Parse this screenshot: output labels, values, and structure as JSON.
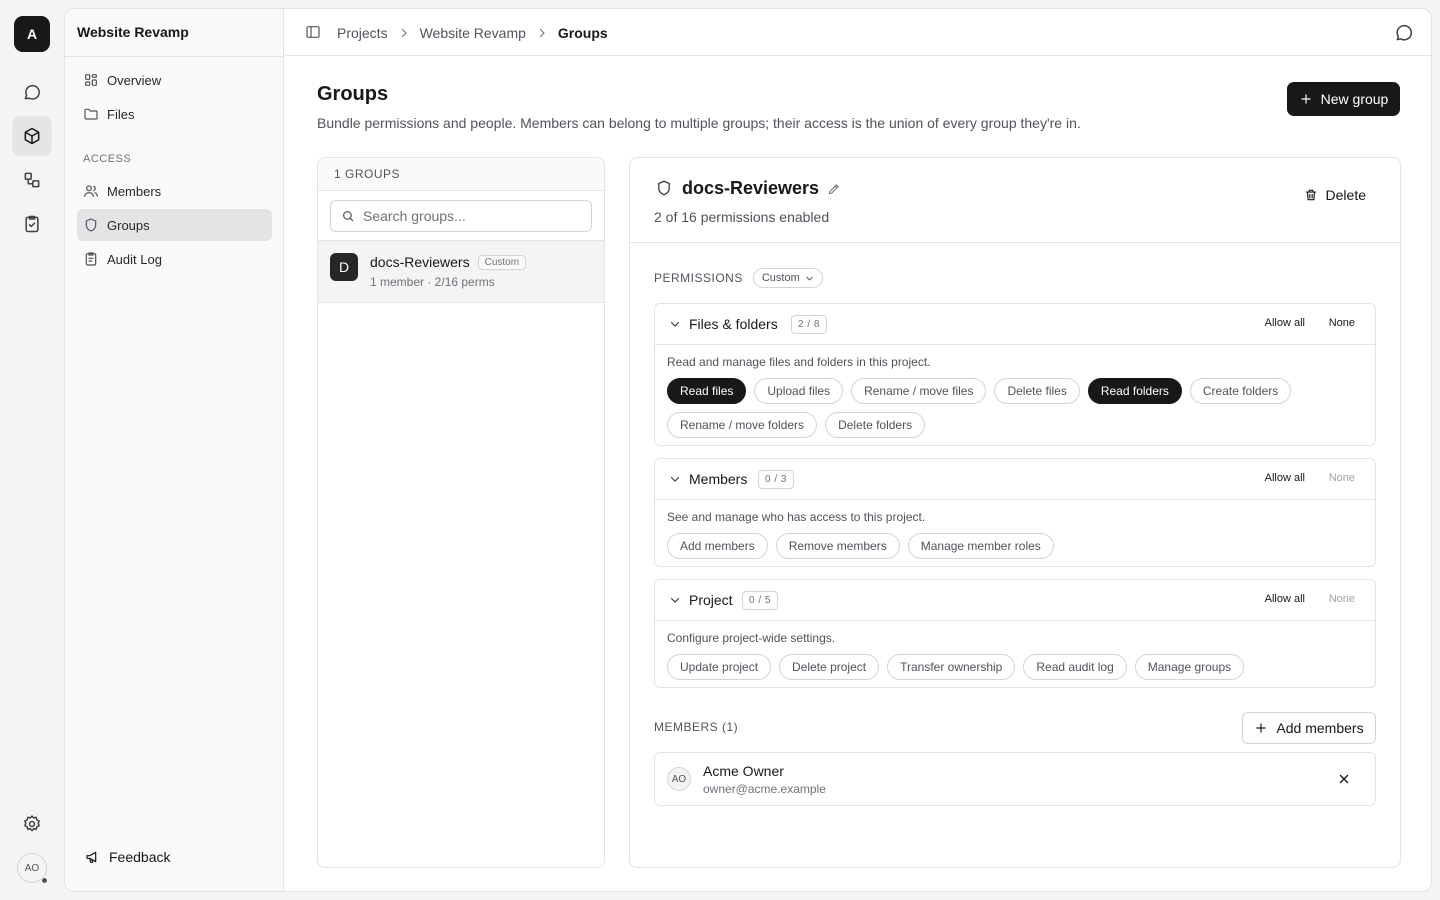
{
  "app": {
    "logo_letter": "A",
    "user_initials": "AO"
  },
  "rail": {
    "items": [
      "chat-icon",
      "cube-icon",
      "workflow-icon",
      "clipboard-check-icon"
    ],
    "active": "cube-icon"
  },
  "sidebar": {
    "project_name": "Website Revamp",
    "items": [
      {
        "label": "Overview",
        "icon": "grid-icon"
      },
      {
        "label": "Files",
        "icon": "folder-icon"
      }
    ],
    "section_label": "ACCESS",
    "access_items": [
      {
        "label": "Members",
        "icon": "users-icon"
      },
      {
        "label": "Groups",
        "icon": "shield-icon",
        "active": true
      },
      {
        "label": "Audit Log",
        "icon": "clipboard-list-icon"
      }
    ],
    "feedback_label": "Feedback"
  },
  "breadcrumb": {
    "items": [
      "Projects",
      "Website Revamp",
      "Groups"
    ]
  },
  "header": {
    "title": "Groups",
    "description": "Bundle permissions and people. Members can belong to multiple groups; their access is the union of every group they're in.",
    "new_group_label": "New group"
  },
  "groups_list": {
    "count_label": "1 GROUPS",
    "search_placeholder": "Search groups...",
    "groups": [
      {
        "initial": "D",
        "name": "docs-Reviewers",
        "badge": "Custom",
        "meta": "1 member · 2/16 perms"
      }
    ]
  },
  "detail": {
    "name": "docs-Reviewers",
    "subtitle": "2 of 16 permissions enabled",
    "delete_label": "Delete",
    "permissions_label": "PERMISSIONS",
    "preset_select": "Custom",
    "allow_all_label": "Allow all",
    "none_label": "None",
    "categories": [
      {
        "name": "Files & folders",
        "count": "2 / 8",
        "description": "Read and manage files and folders in this project.",
        "permissions": [
          {
            "label": "Read files",
            "enabled": true
          },
          {
            "label": "Upload files",
            "enabled": false
          },
          {
            "label": "Rename / move files",
            "enabled": false
          },
          {
            "label": "Delete files",
            "enabled": false
          },
          {
            "label": "Read folders",
            "enabled": true
          },
          {
            "label": "Create folders",
            "enabled": false
          },
          {
            "label": "Rename / move folders",
            "enabled": false
          },
          {
            "label": "Delete folders",
            "enabled": false
          }
        ]
      },
      {
        "name": "Members",
        "count": "0 / 3",
        "description": "See and manage who has access to this project.",
        "permissions": [
          {
            "label": "Add members",
            "enabled": false
          },
          {
            "label": "Remove members",
            "enabled": false
          },
          {
            "label": "Manage member roles",
            "enabled": false
          }
        ]
      },
      {
        "name": "Project",
        "count": "0 / 5",
        "description": "Configure project-wide settings.",
        "permissions": [
          {
            "label": "Update project",
            "enabled": false
          },
          {
            "label": "Delete project",
            "enabled": false
          },
          {
            "label": "Transfer ownership",
            "enabled": false
          },
          {
            "label": "Read audit log",
            "enabled": false
          },
          {
            "label": "Manage groups",
            "enabled": false
          }
        ]
      }
    ],
    "members_label": "MEMBERS (1)",
    "add_members_label": "Add members",
    "members": [
      {
        "initials": "AO",
        "name": "Acme Owner",
        "email": "owner@acme.example"
      }
    ]
  }
}
